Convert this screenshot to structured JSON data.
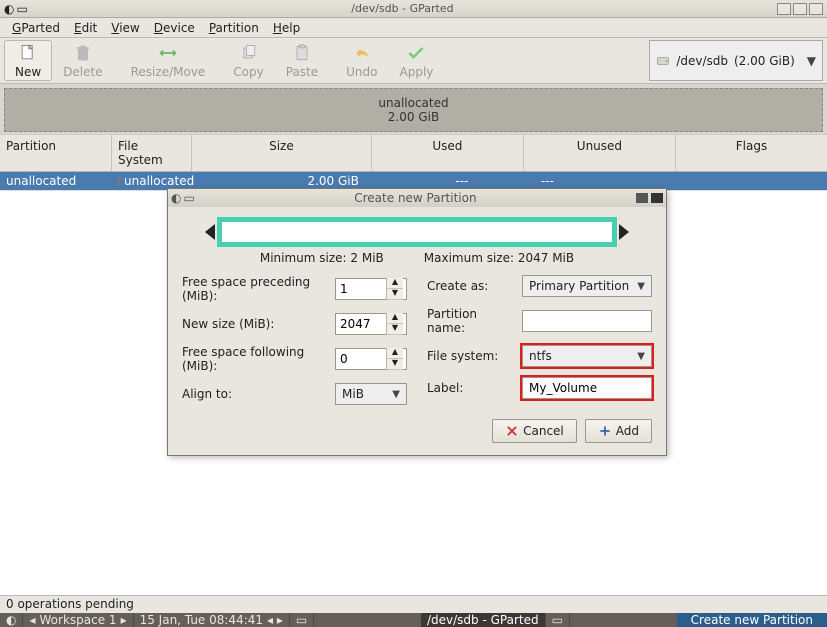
{
  "window": {
    "title": "/dev/sdb - GParted"
  },
  "menubar": {
    "items": [
      {
        "label": "GParted",
        "accel": "G"
      },
      {
        "label": "Edit",
        "accel": "E"
      },
      {
        "label": "View",
        "accel": "V"
      },
      {
        "label": "Device",
        "accel": "D"
      },
      {
        "label": "Partition",
        "accel": "P"
      },
      {
        "label": "Help",
        "accel": "H"
      }
    ]
  },
  "toolbar": {
    "new": "New",
    "delete": "Delete",
    "resize": "Resize/Move",
    "copy": "Copy",
    "paste": "Paste",
    "undo": "Undo",
    "apply": "Apply",
    "device": {
      "name": "/dev/sdb",
      "size": "(2.00 GiB)"
    }
  },
  "diskmap": {
    "name": "unallocated",
    "size": "2.00 GiB"
  },
  "table": {
    "headers": {
      "partition": "Partition",
      "fs": "File System",
      "size": "Size",
      "used": "Used",
      "unused": "Unused",
      "flags": "Flags"
    },
    "rows": [
      {
        "partition": "unallocated",
        "fs": "unallocated",
        "size": "2.00 GiB",
        "used": "---",
        "unused": "---",
        "flags": ""
      }
    ]
  },
  "dialog": {
    "title": "Create new Partition",
    "min_label": "Minimum size: 2 MiB",
    "max_label": "Maximum size: 2047 MiB",
    "left": {
      "preceding_label": "Free space preceding (MiB):",
      "preceding_value": "1",
      "newsize_label": "New size (MiB):",
      "newsize_value": "2047",
      "following_label": "Free space following (MiB):",
      "following_value": "0",
      "align_label": "Align to:",
      "align_value": "MiB"
    },
    "right": {
      "createas_label": "Create as:",
      "createas_value": "Primary Partition",
      "partname_label": "Partition name:",
      "partname_value": "",
      "fs_label": "File system:",
      "fs_value": "ntfs",
      "label_label": "Label:",
      "label_value": "My_Volume"
    },
    "buttons": {
      "cancel": "Cancel",
      "add": "Add"
    }
  },
  "status": {
    "pending": "0 operations pending"
  },
  "taskbar": {
    "workspace": "Workspace 1",
    "clock": "15 Jan, Tue 08:44:41",
    "app": "/dev/sdb - GParted",
    "tray": "Create new Partition"
  }
}
